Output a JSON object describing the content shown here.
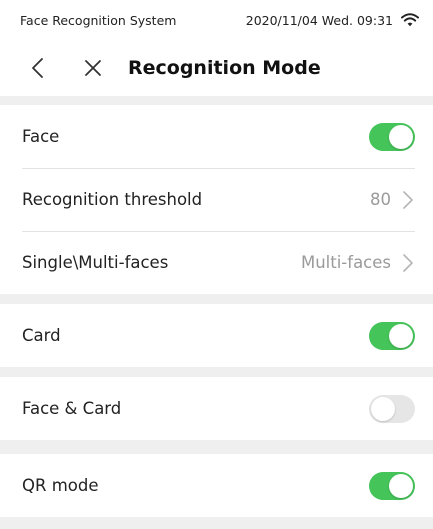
{
  "status_bar": {
    "app_name": "Face Recognition System",
    "datetime": "2020/11/04 Wed. 09:31",
    "wifi_icon": "wifi-icon"
  },
  "nav": {
    "back_icon": "chevron-left-icon",
    "close_icon": "close-icon",
    "title": "Recognition Mode"
  },
  "colors": {
    "toggle_on": "#45c459",
    "toggle_off": "#e6e6e6",
    "background": "#efefef"
  },
  "settings": {
    "face": {
      "label": "Face",
      "enabled": true
    },
    "threshold": {
      "label": "Recognition threshold",
      "value": "80"
    },
    "faces_mode": {
      "label": "Single\\Multi-faces",
      "value": "Multi-faces"
    },
    "card": {
      "label": "Card",
      "enabled": true
    },
    "face_card": {
      "label": "Face & Card",
      "enabled": false
    },
    "qr": {
      "label": "QR mode",
      "enabled": true
    }
  }
}
